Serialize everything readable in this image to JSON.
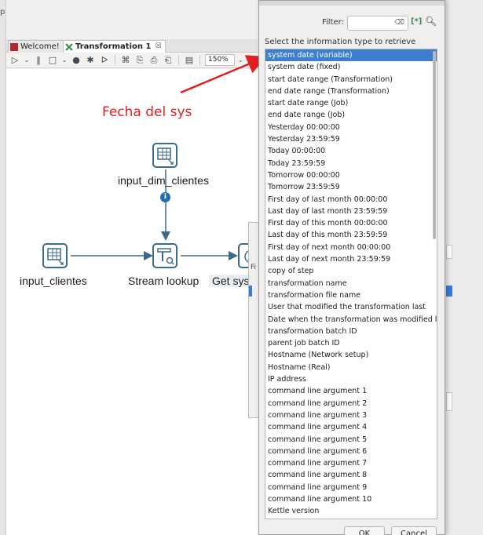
{
  "left_strip": {
    "label": "p"
  },
  "tabs": [
    {
      "label": "Welcome!",
      "active": false
    },
    {
      "label": "Transformation 1",
      "active": true,
      "close": "☒"
    }
  ],
  "toolbar": {
    "zoom_value": "150%"
  },
  "canvas": {
    "steps": {
      "input_dim_clientes": "input_dim_clientes",
      "input_clientes": "input_clientes",
      "stream_lookup": "Stream lookup",
      "get_system_info": "Get sys"
    },
    "annotation": "Fecha del sys",
    "info_badge": "i"
  },
  "dialog": {
    "filter_label": "Filter:",
    "instruction": "Select the information type to retrieve",
    "selected_index": 0,
    "items": [
      "system date (variable)",
      "system date (fixed)",
      "start date range (Transformation)",
      "end date range (Transformation)",
      "start date range (Job)",
      "end date range (Job)",
      "Yesterday 00:00:00",
      "Yesterday 23:59:59",
      "Today 00:00:00",
      "Today 23:59:59",
      "Tomorrow 00:00:00",
      "Tomorrow 23:59:59",
      "First day of last month 00:00:00",
      "Last day of last month 23:59:59",
      "First day of this month 00:00:00",
      "Last day of this month 23:59:59",
      "First day of next month 00:00:00",
      "Last day of next month 23:59:59",
      "copy of step",
      "transformation name",
      "transformation file name",
      "User that modified the transformation last",
      "Date when the transformation was modified last",
      "transformation batch ID",
      "parent job batch ID",
      "Hostname (Network setup)",
      "Hostname (Real)",
      "IP address",
      "command line argument 1",
      "command line argument 2",
      "command line argument 3",
      "command line argument 4",
      "command line argument 5",
      "command line argument 6",
      "command line argument 7",
      "command line argument 8",
      "command line argument 9",
      "command line argument 10",
      "Kettle version"
    ],
    "ok_label": "OK",
    "cancel_label": "Cancel"
  },
  "colors": {
    "selection": "#3c7fd1",
    "annotation": "#e02020",
    "step_border": "#3d6b8c",
    "hop": "#3d6b8c"
  }
}
